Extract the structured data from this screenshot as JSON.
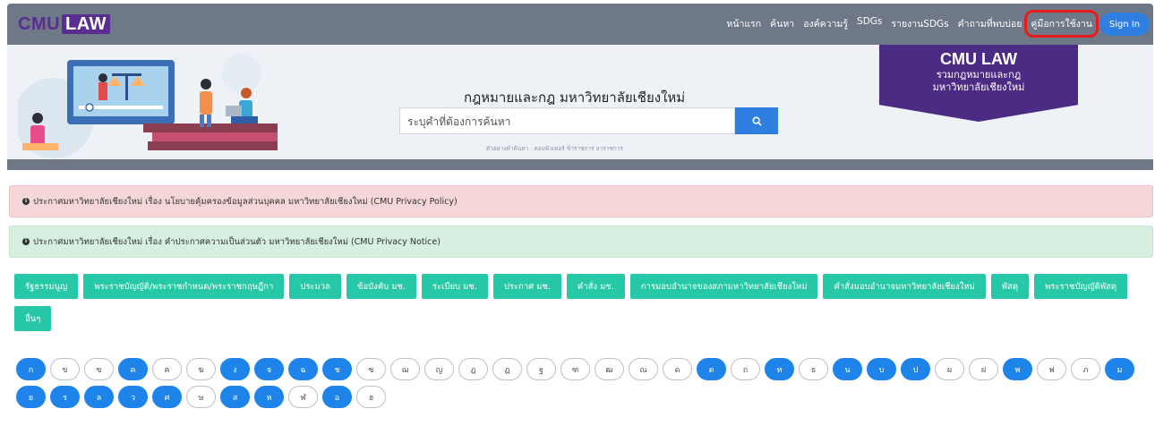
{
  "header": {
    "logo_cmu": "CMU",
    "logo_law": "LAW",
    "nav": [
      "หน้าแรก",
      "ค้นหา",
      "องค์ความรู้",
      "SDGs",
      "รายงานSDGs",
      "คำถามที่พบบ่อย",
      "คู่มือการใช้งาน"
    ],
    "signin": "Sign In"
  },
  "hero": {
    "title": "กฎหมายและกฎ มหาวิทยาลัยเชียงใหม่",
    "search_placeholder": "ระบุคำที่ต้องการค้นหา",
    "search_hint": "ตัวอย่างคำค้นหา : คอมพิวเตอร์ ข้าราชการ ลาราชการ",
    "banner_line1": "CMU LAW",
    "banner_line2": "รวมกฎหมายและกฎ",
    "banner_line3": "มหาวิทยาลัยเชียงใหม่"
  },
  "alerts": [
    "ประกาศมหาวิทยาลัยเชียงใหม่ เรื่อง นโยบายคุ้มครองข้อมูลส่วนบุคคล มหาวิทยาลัยเชียงใหม่ (CMU Privacy Policy)",
    "ประกาศมหาวิทยาลัยเชียงใหม่ เรื่อง คำประกาศความเป็นส่วนตัว มหาวิทยาลัยเชียงใหม่ (CMU Privacy Notice)"
  ],
  "categories": [
    "รัฐธรรมนูญ",
    "พระราชบัญญัติ/พระราชกำหนด/พระราชกฤษฎีกา",
    "ประมวล",
    "ข้อบังคับ มช.",
    "ระเบียบ มช.",
    "ประกาศ มช.",
    "คำสั่ง มช.",
    "การมอบอำนาจของสภามหาวิทยาลัยเชียงใหม่",
    "คำสั่งมอบอำนาจมหาวิทยาลัยเชียงใหม่",
    "พัสดุ",
    "พระราชบัญญัติพัสดุ",
    "อื่นๆ"
  ],
  "letters": [
    {
      "ch": "ก",
      "active": true
    },
    {
      "ch": "ข",
      "active": false
    },
    {
      "ch": "ฃ",
      "active": false
    },
    {
      "ch": "ค",
      "active": true
    },
    {
      "ch": "ฅ",
      "active": false
    },
    {
      "ch": "ฆ",
      "active": false
    },
    {
      "ch": "ง",
      "active": true
    },
    {
      "ch": "จ",
      "active": true
    },
    {
      "ch": "ฉ",
      "active": true
    },
    {
      "ch": "ช",
      "active": true
    },
    {
      "ch": "ซ",
      "active": false
    },
    {
      "ch": "ฌ",
      "active": false
    },
    {
      "ch": "ญ",
      "active": false
    },
    {
      "ch": "ฎ",
      "active": false
    },
    {
      "ch": "ฏ",
      "active": false
    },
    {
      "ch": "ฐ",
      "active": false
    },
    {
      "ch": "ฑ",
      "active": false
    },
    {
      "ch": "ฒ",
      "active": false
    },
    {
      "ch": "ณ",
      "active": false
    },
    {
      "ch": "ด",
      "active": false
    },
    {
      "ch": "ต",
      "active": true
    },
    {
      "ch": "ถ",
      "active": false
    },
    {
      "ch": "ท",
      "active": true
    },
    {
      "ch": "ธ",
      "active": false
    },
    {
      "ch": "น",
      "active": true
    },
    {
      "ch": "บ",
      "active": true
    },
    {
      "ch": "ป",
      "active": true
    },
    {
      "ch": "ผ",
      "active": false
    },
    {
      "ch": "ฝ",
      "active": false
    },
    {
      "ch": "พ",
      "active": true
    },
    {
      "ch": "ฟ",
      "active": false
    },
    {
      "ch": "ภ",
      "active": false
    },
    {
      "ch": "ม",
      "active": true
    },
    {
      "ch": "ย",
      "active": true
    },
    {
      "ch": "ร",
      "active": true
    },
    {
      "ch": "ล",
      "active": true
    },
    {
      "ch": "ว",
      "active": true
    },
    {
      "ch": "ศ",
      "active": true
    },
    {
      "ch": "ษ",
      "active": false
    },
    {
      "ch": "ส",
      "active": true
    },
    {
      "ch": "ห",
      "active": true
    },
    {
      "ch": "ฬ",
      "active": false
    },
    {
      "ch": "อ",
      "active": true
    },
    {
      "ch": "ฮ",
      "active": false
    }
  ],
  "colors": {
    "primary": "#2f7fe0",
    "brand": "#5a2d91",
    "category": "#27c8a7",
    "highlight_outline": "#e81c1c"
  }
}
